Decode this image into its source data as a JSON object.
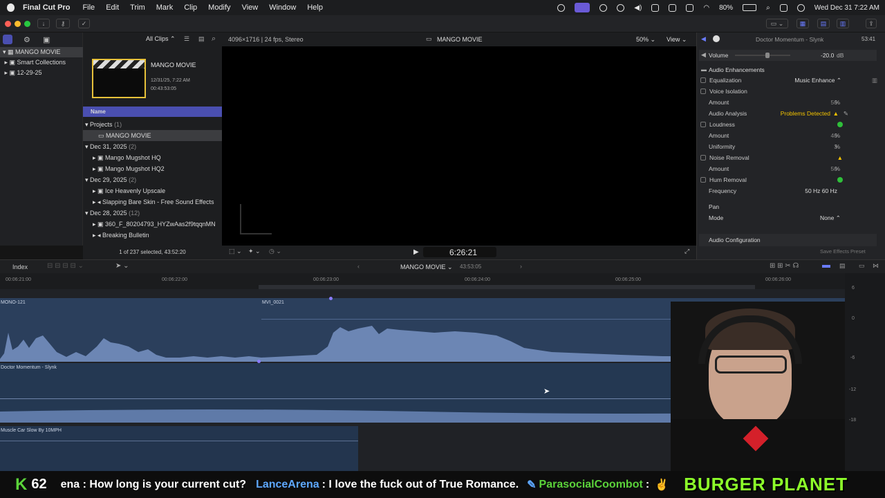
{
  "menubar": {
    "app": "Final Cut Pro",
    "items": [
      "File",
      "Edit",
      "Trim",
      "Mark",
      "Clip",
      "Modify",
      "View",
      "Window",
      "Help"
    ],
    "battery": "80%",
    "clock": "Wed Dec 31  7:22 AM"
  },
  "browser": {
    "filter": "All Clips",
    "library": "MANGO MOVIE",
    "library_items": [
      "Smart Collections",
      "12-29-25"
    ],
    "project_thumb": {
      "title": "MANGO MOVIE",
      "date": "12/31/25, 7:22 AM",
      "duration": "00:43:53:05"
    },
    "column_header": "Name",
    "groups": [
      {
        "label": "Projects",
        "count": "(1)",
        "items": [
          "MANGO MOVIE"
        ]
      },
      {
        "label": "Dec 31, 2025",
        "count": "(2)",
        "items": [
          "Mango Mugshot HQ",
          "Mango Mugshot HQ2"
        ]
      },
      {
        "label": "Dec 29, 2025",
        "count": "(2)",
        "items": [
          "Ice Heavenly Upscale",
          "Slapping Bare Skin - Free Sound Effects"
        ]
      },
      {
        "label": "Dec 28, 2025",
        "count": "(12)",
        "items": [
          "360_F_80204793_HYZwAas2f9tqqnMN",
          "Breaking Bulletin"
        ]
      }
    ],
    "selection_status": "1 of 237 selected, 43:52:20"
  },
  "viewer": {
    "format": "4096×1716 | 24 fps, Stereo",
    "title": "MANGO MOVIE",
    "zoom": "50%",
    "view_menu": "View",
    "timecode": "6:26:21"
  },
  "inspector": {
    "clip_name": "Doctor Momentum - Slynk",
    "duration": "53:41",
    "volume_label": "Volume",
    "volume_value": "-20.0",
    "volume_unit": "dB",
    "section": "Audio Enhancements",
    "rows": [
      {
        "label": "Equalization",
        "cb": true,
        "right": "Music Enhance ⌃"
      },
      {
        "label": "Voice Isolation",
        "cb": true,
        "right": ""
      },
      {
        "label": "Amount",
        "cb": false,
        "val": "50",
        "unit": "%"
      },
      {
        "label": "Audio Analysis",
        "cb": false,
        "right": "Problems Detected"
      },
      {
        "label": "Loudness",
        "cb": true,
        "right": ""
      },
      {
        "label": "Amount",
        "cb": false,
        "val": "40",
        "unit": "%"
      },
      {
        "label": "Uniformity",
        "cb": false,
        "val": "3",
        "unit": "%"
      },
      {
        "label": "Noise Removal",
        "cb": true,
        "right": ""
      },
      {
        "label": "Amount",
        "cb": false,
        "val": "50",
        "unit": "%"
      },
      {
        "label": "Hum Removal",
        "cb": true,
        "right": ""
      },
      {
        "label": "Frequency",
        "cb": false,
        "right": "50 Hz    60 Hz"
      }
    ],
    "pan_label": "Pan",
    "mode_label": "Mode",
    "mode_value": "None",
    "audio_config": "Audio Configuration",
    "save_preset": "Save Effects Preset"
  },
  "timeline": {
    "index": "Index",
    "project": "MANGO MOVIE",
    "duration": "43:53:05",
    "ruler": [
      "00:06:21:00",
      "00:06:22:00",
      "00:06:23:00",
      "00:06:24:00",
      "00:06:25:00",
      "00:06:26:00"
    ],
    "clips": {
      "a": "MONO-121",
      "b": "MVI_0021",
      "music": "Doctor Momentum - Slynk",
      "sfx": "Muscle Car Slow By 10MPH"
    },
    "meter_labels": [
      "6",
      "0",
      "-6",
      "-12",
      "-18"
    ]
  },
  "chat": {
    "count": "62",
    "msg1": "ena : How long is your current cut?",
    "user2": "LanceArena",
    "msg2": ": I love the fuck out of True Romance.",
    "user3": "ParasocialCoombot",
    "msg3": ":",
    "brand": "BURGER PLANET"
  },
  "colors": {
    "accent": "#4a4fb0",
    "clip_blue": "#2b3f5c",
    "warning": "#f2c200",
    "ok": "#2fbf3a",
    "chat_green": "#5bd23a",
    "lime": "#8dff2a"
  }
}
